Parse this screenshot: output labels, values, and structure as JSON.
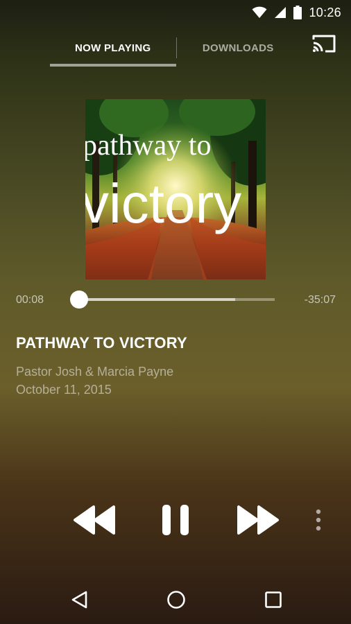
{
  "status_bar": {
    "time": "10:26",
    "icons": [
      "wifi-icon",
      "cell-signal-icon",
      "battery-icon"
    ]
  },
  "tabs": [
    {
      "label": "NOW PLAYING",
      "active": true
    },
    {
      "label": "DOWNLOADS",
      "active": false
    }
  ],
  "cast_icon": "cast-icon",
  "album_art": {
    "line1": "pathway to",
    "line2": "victory"
  },
  "player": {
    "elapsed": "00:08",
    "remaining": "-35:07",
    "progress": 0.004,
    "buffered": 0.8
  },
  "track": {
    "title": "PATHWAY TO VICTORY",
    "artist": "Pastor Josh & Marcia Payne",
    "date": "October 11, 2015"
  },
  "controls": {
    "icons": [
      "rewind-icon",
      "pause-icon",
      "fast-forward-icon",
      "more-vert-icon"
    ]
  },
  "nav_bar": {
    "icons": [
      "back-icon",
      "home-icon",
      "recents-icon"
    ]
  },
  "colors": {
    "accent": "#ffffff",
    "background_top": "#1d1f12",
    "background_mid": "#6b5f2b",
    "background_bottom": "#2a1b12"
  }
}
